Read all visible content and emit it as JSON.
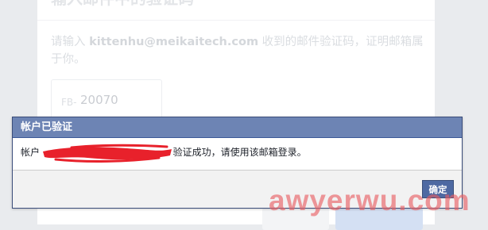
{
  "background_page": {
    "heading": "输入邮件中的验证码",
    "description_before": "请输入 ",
    "email": "kittenhu@meikaitech.com",
    "description_after": " 收到的邮件验证码，证明邮箱属于你。",
    "code_prefix": "FB-",
    "code_value": "20070"
  },
  "dialog": {
    "title": "帐户已验证",
    "message_before": "帐户 ",
    "message_after": " 验证成功，请使用该邮箱登录。",
    "ok_label": "确定"
  },
  "watermark": {
    "text": "awyerwu.com"
  },
  "colors": {
    "dialog_header": "#6d84b4",
    "dialog_border": "#3b4d7a",
    "ok_button": "#4e69a2",
    "redaction": "#e8212b",
    "watermark": "#e85a5f"
  }
}
